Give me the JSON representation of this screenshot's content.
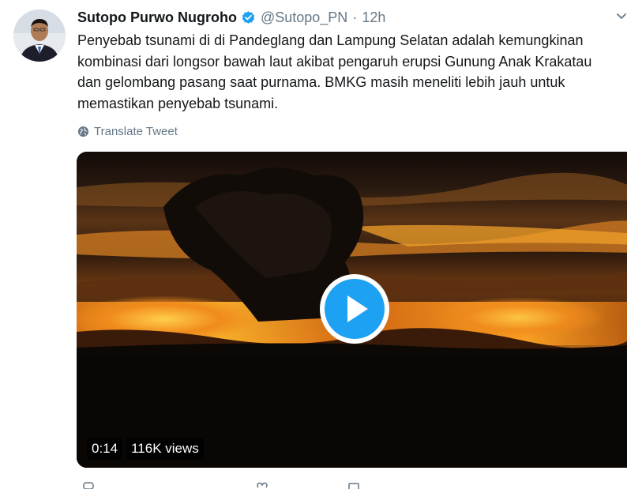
{
  "author": {
    "name": "Sutopo Purwo Nugroho",
    "handle": "@Sutopo_PN",
    "separator": "·",
    "time": "12h"
  },
  "tweet": {
    "lines": [
      "Penyebab tsunami di di Pandeglang dan Lampung Selatan adalah kemungkinan",
      "kombinasi dari longsor bawah laut akibat pengaruh erupsi Gunung Anak Krakatau",
      "dan gelombang pasang saat purnama.  BMKG masih meneliti lebih jauh untuk",
      "memastikan penyebab tsunami."
    ]
  },
  "translate": {
    "label": "Translate Tweet"
  },
  "video": {
    "duration": "0:14",
    "views": "116K views"
  },
  "icons": {
    "verified": "verified-badge-icon",
    "caret": "chevron-down-icon",
    "globe": "globe-icon",
    "play": "play-icon"
  },
  "colors": {
    "accent": "#1da1f2",
    "muted": "#657786",
    "text": "#14171a"
  }
}
